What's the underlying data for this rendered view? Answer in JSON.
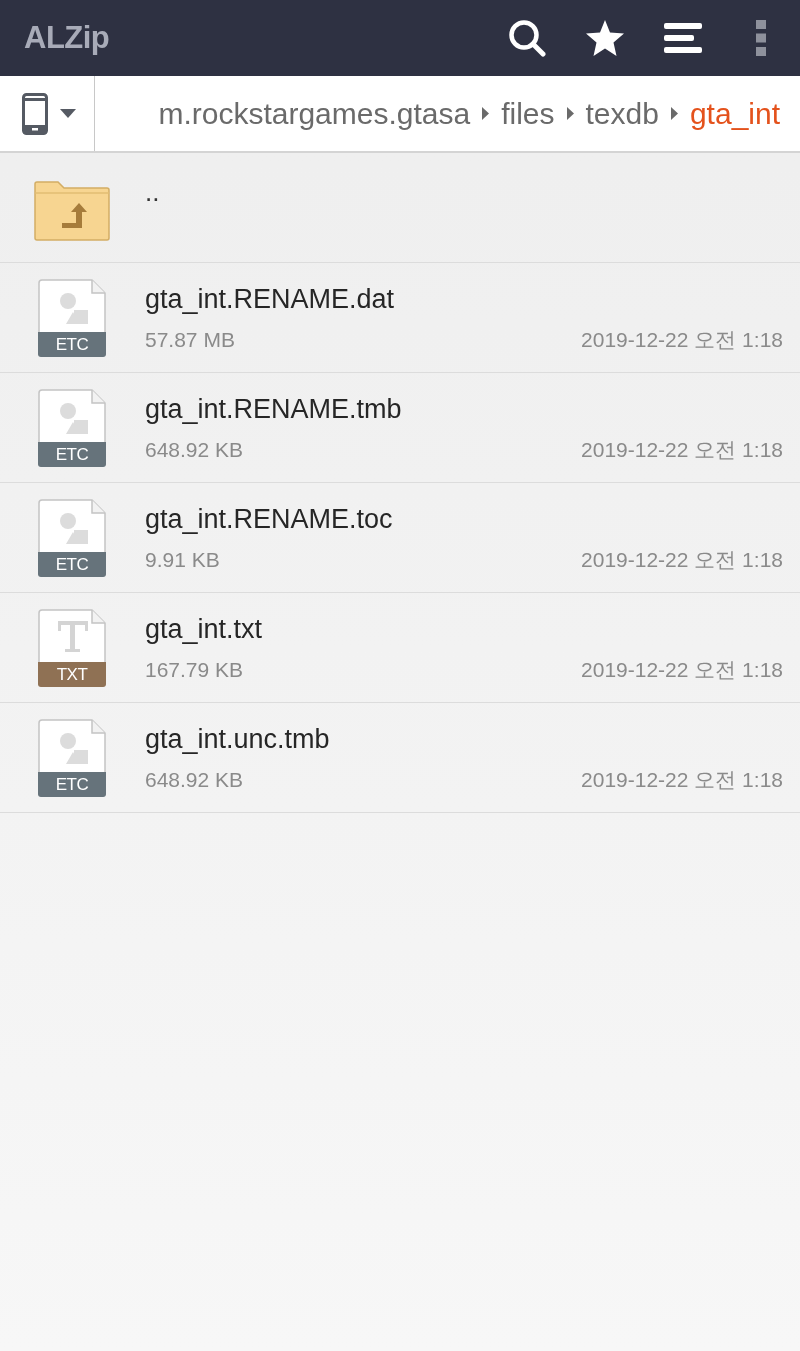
{
  "app_bar": {
    "title": "ALZip"
  },
  "breadcrumb": {
    "segments": [
      {
        "label": "m.rockstargames.gtasa",
        "selected": false
      },
      {
        "label": "files",
        "selected": false
      },
      {
        "label": "texdb",
        "selected": false
      },
      {
        "label": "gta_int",
        "selected": true
      }
    ]
  },
  "parent_row": {
    "label": ".."
  },
  "files": [
    {
      "name": "gta_int.RENAME.dat",
      "size": "57.87 MB",
      "modified": "2019-12-22 오전 1:18",
      "kind": "etc",
      "badge": "ETC"
    },
    {
      "name": "gta_int.RENAME.tmb",
      "size": "648.92 KB",
      "modified": "2019-12-22 오전 1:18",
      "kind": "etc",
      "badge": "ETC"
    },
    {
      "name": "gta_int.RENAME.toc",
      "size": "9.91 KB",
      "modified": "2019-12-22 오전 1:18",
      "kind": "etc",
      "badge": "ETC"
    },
    {
      "name": "gta_int.txt",
      "size": "167.79 KB",
      "modified": "2019-12-22 오전 1:18",
      "kind": "txt",
      "badge": "TXT"
    },
    {
      "name": "gta_int.unc.tmb",
      "size": "648.92 KB",
      "modified": "2019-12-22 오전 1:18",
      "kind": "etc",
      "badge": "ETC"
    }
  ]
}
